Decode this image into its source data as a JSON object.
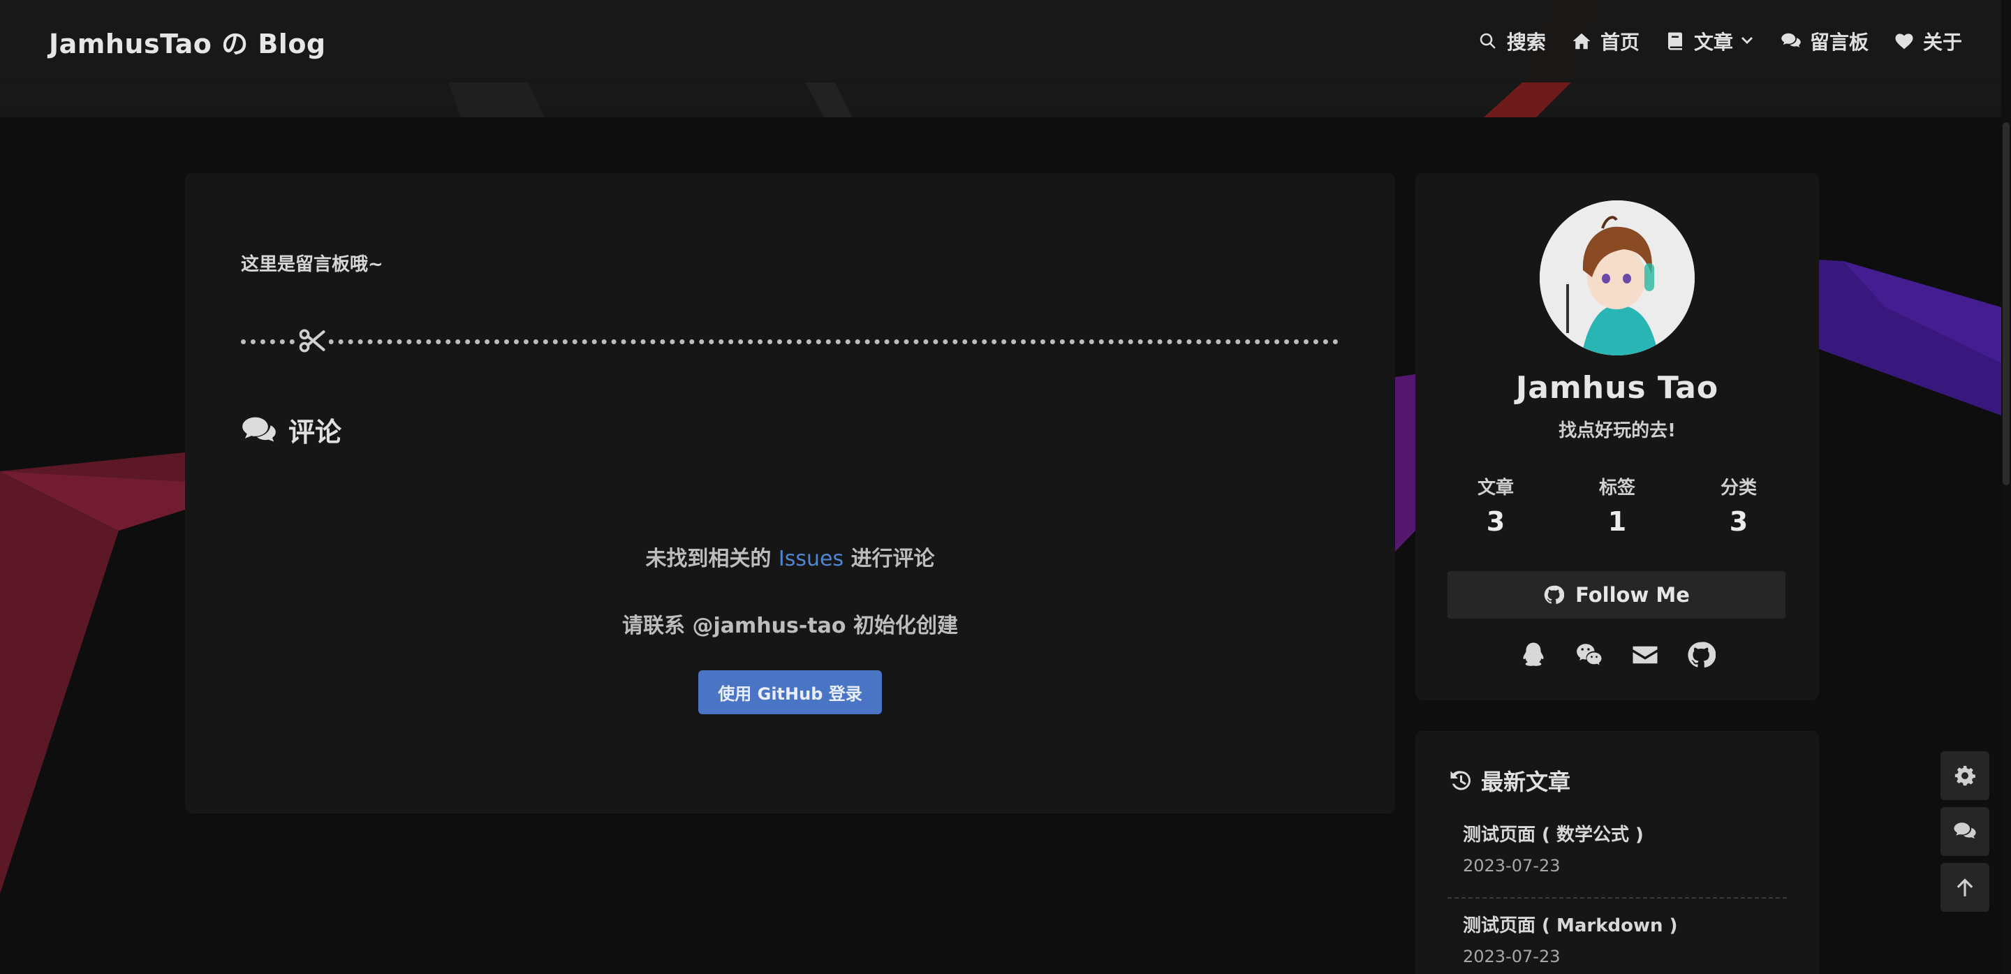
{
  "brand": "JamhusTao の Blog",
  "nav": {
    "search": "搜索",
    "home": "首页",
    "articles": "文章",
    "guestbook": "留言板",
    "about": "关于"
  },
  "main": {
    "intro": "这里是留言板哦~",
    "comments_heading": "评论",
    "notice_prefix": "未找到相关的",
    "notice_link": "Issues",
    "notice_suffix": "进行评论",
    "contact": "请联系 @jamhus-tao 初始化创建",
    "login_button": "使用 GitHub 登录"
  },
  "profile": {
    "name": "Jamhus Tao",
    "motto": "找点好玩的去!",
    "stats": [
      {
        "label": "文章",
        "value": "3"
      },
      {
        "label": "标签",
        "value": "1"
      },
      {
        "label": "分类",
        "value": "3"
      }
    ],
    "follow": "Follow Me",
    "socials": [
      "qq-icon",
      "wechat-icon",
      "email-icon",
      "github-icon"
    ]
  },
  "recent": {
    "title": "最新文章",
    "posts": [
      {
        "title": "测试页面 ( 数学公式 )",
        "date": "2023-07-23"
      },
      {
        "title": "测试页面 ( Markdown )",
        "date": "2023-07-23"
      }
    ]
  },
  "colors": {
    "background": "#0e0e0e",
    "card": "#161616",
    "link": "#4f86d1",
    "button": "#4a75c4"
  }
}
